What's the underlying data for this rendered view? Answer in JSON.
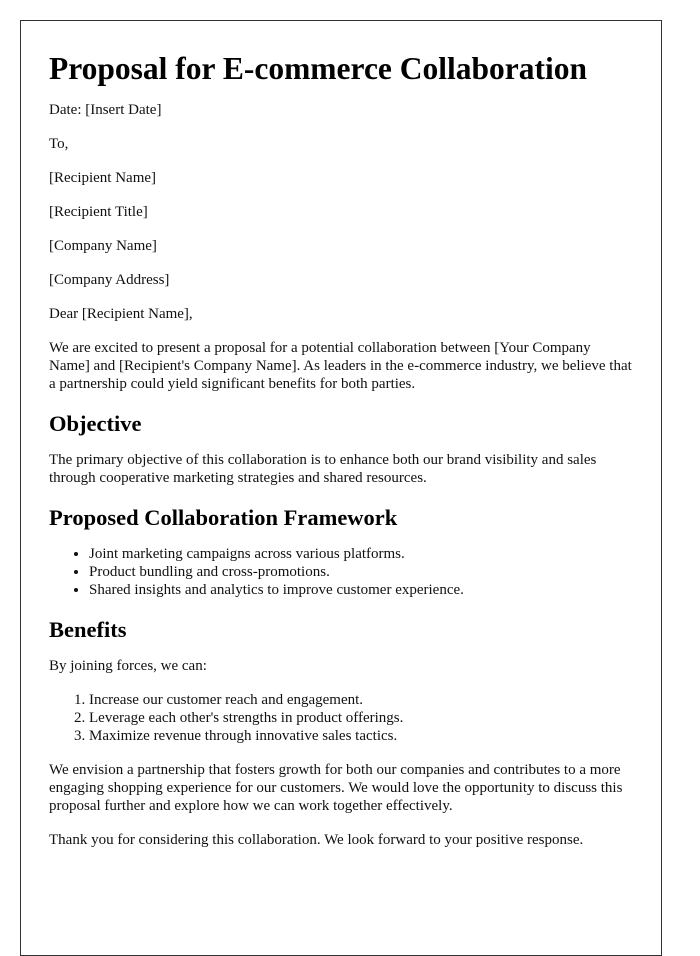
{
  "document": {
    "title": "Proposal for E-commerce Collaboration",
    "header_lines": [
      "Date: [Insert Date]",
      "To,",
      "[Recipient Name]",
      "[Recipient Title]",
      "[Company Name]",
      "[Company Address]",
      "Dear [Recipient Name],"
    ],
    "intro": "We are excited to present a proposal for a potential collaboration between [Your Company Name] and [Recipient's Company Name]. As leaders in the e-commerce industry, we believe that a partnership could yield significant benefits for both parties.",
    "sections": [
      {
        "heading": "Objective",
        "paragraph": "The primary objective of this collaboration is to enhance both our brand visibility and sales through cooperative marketing strategies and shared resources."
      },
      {
        "heading": "Proposed Collaboration Framework",
        "bullets": [
          "Joint marketing campaigns across various platforms.",
          "Product bundling and cross-promotions.",
          "Shared insights and analytics to improve customer experience."
        ]
      },
      {
        "heading": "Benefits",
        "paragraph": "By joining forces, we can:",
        "numbered": [
          "Increase our customer reach and engagement.",
          "Leverage each other's strengths in product offerings.",
          "Maximize revenue through innovative sales tactics."
        ]
      }
    ],
    "closing_paragraphs": [
      "We envision a partnership that fosters growth for both our companies and contributes to a more engaging shopping experience for our customers. We would love the opportunity to discuss this proposal further and explore how we can work together effectively.",
      "Thank you for considering this collaboration. We look forward to your positive response."
    ]
  }
}
